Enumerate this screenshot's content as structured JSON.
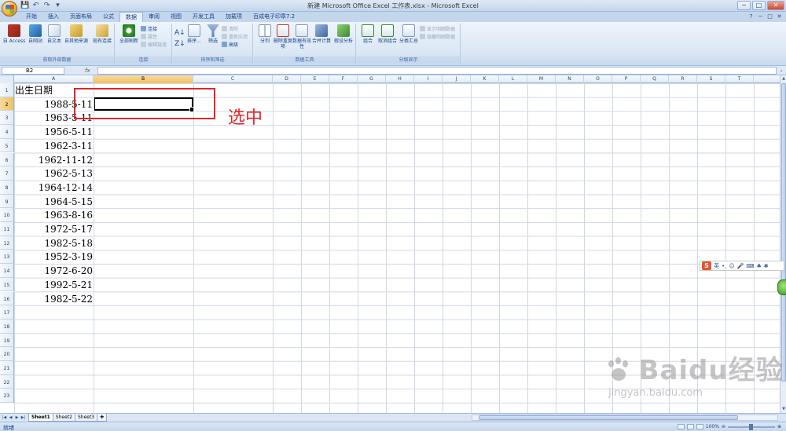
{
  "window": {
    "title": "新建 Microsoft Office Excel 工作表.xlsx - Microsoft Excel",
    "min_label": "─",
    "max_label": "□",
    "close_label": "✕"
  },
  "qat": [
    "💾",
    "↶",
    "↷",
    "▾"
  ],
  "tabs": [
    "开始",
    "插入",
    "页面布局",
    "公式",
    "数据",
    "审阅",
    "视图",
    "开发工具",
    "加载项",
    "百成电子印章7.2"
  ],
  "active_tab": "数据",
  "ribbon": {
    "groups": [
      {
        "label": "获取外部数据",
        "buttons": [
          "自 Access",
          "自网站",
          "自文本",
          "自其他来源",
          "现有连接"
        ]
      },
      {
        "label": "连接",
        "buttons": [
          "全部刷新"
        ],
        "small": [
          "连接",
          "属性",
          "编辑链接"
        ]
      },
      {
        "label": "排序和筛选",
        "buttons": [
          "排序...",
          "筛选"
        ],
        "small": [
          "清除",
          "重新应用",
          "高级"
        ]
      },
      {
        "label": "数据工具",
        "buttons": [
          "分列",
          "删除重复项",
          "数据有效性",
          "合并计算",
          "假设分析"
        ]
      },
      {
        "label": "分级显示",
        "buttons": [
          "组合",
          "取消组合",
          "分类汇总"
        ],
        "small": [
          "显示明细数据",
          "隐藏明细数据"
        ]
      }
    ]
  },
  "formula_bar": {
    "name_box": "B2",
    "fx": "fx",
    "value": ""
  },
  "columns": [
    "A",
    "B",
    "C",
    "D",
    "E",
    "F",
    "G",
    "H",
    "I",
    "J",
    "K",
    "L",
    "M",
    "N",
    "O",
    "P",
    "Q",
    "R",
    "S",
    "T"
  ],
  "selected_column": "B",
  "selected_row": 2,
  "rows": [
    "1",
    "2",
    "3",
    "4",
    "5",
    "6",
    "7",
    "8",
    "9",
    "10",
    "11",
    "12",
    "13",
    "14",
    "15",
    "16",
    "17",
    "18",
    "19",
    "20",
    "21",
    "22",
    "23"
  ],
  "column_a": {
    "header": "出生日期",
    "values": [
      "1988-5-11",
      "1963-5-11",
      "1956-5-11",
      "1962-3-11",
      "1962-11-12",
      "1962-5-13",
      "1964-12-14",
      "1964-5-15",
      "1963-8-16",
      "1972-5-17",
      "1982-5-18",
      "1952-3-19",
      "1972-6-20",
      "1992-5-21",
      "1982-5-22"
    ]
  },
  "annotation": "选中",
  "sheets": [
    "Sheet1",
    "Sheet2",
    "Sheet3"
  ],
  "active_sheet": "Sheet1",
  "status": {
    "ready": "就绪",
    "zoom": "100%"
  },
  "ime": {
    "lang": "英",
    "logo": "S"
  },
  "watermark": {
    "main": "Baidu经验",
    "sub": "jingyan.baidu.com"
  }
}
